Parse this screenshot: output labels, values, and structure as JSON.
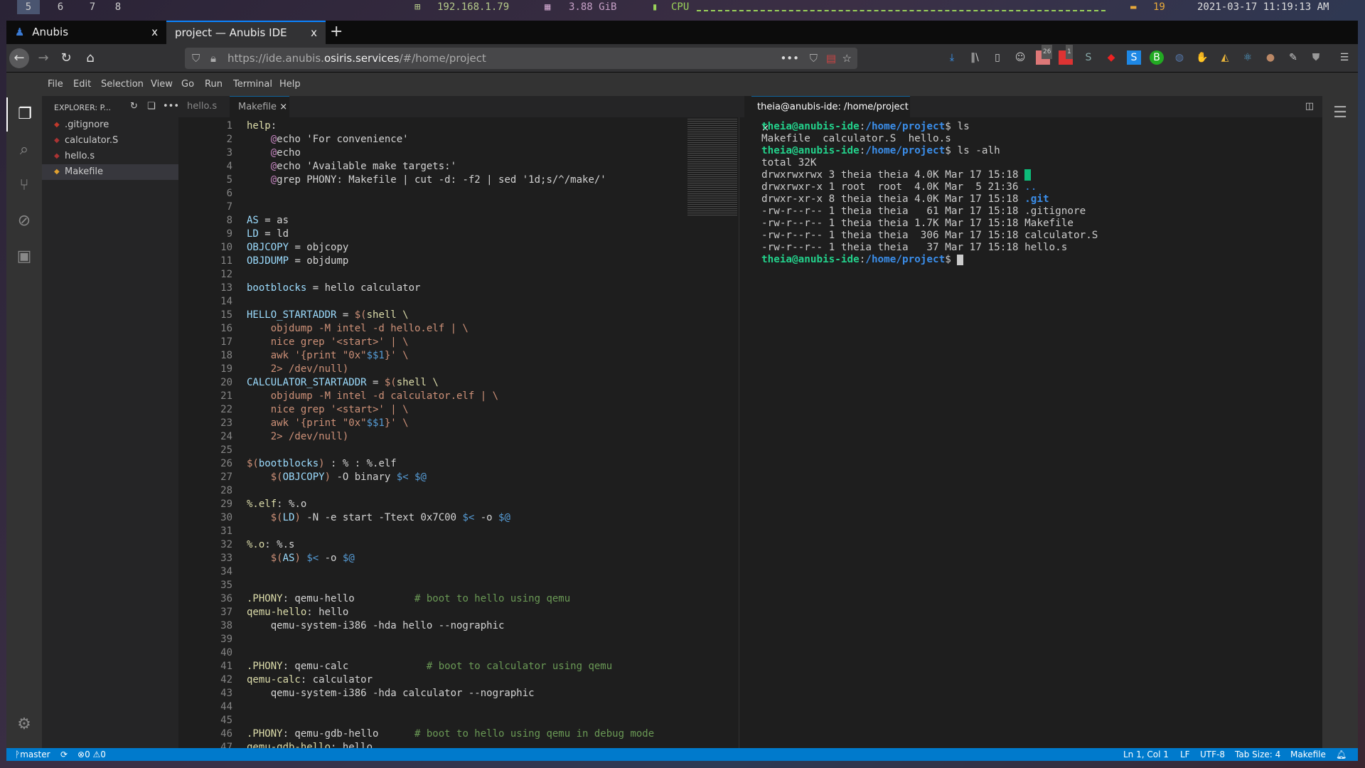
{
  "topbar": {
    "workspaces": [
      "5",
      "6",
      "7",
      "8"
    ],
    "active_workspace": "5",
    "ip": "192.168.1.79",
    "memory": "3.88 GiB",
    "cpu_label": "CPU",
    "disk": "19",
    "datetime": "2021-03-17 11:19:13 AM"
  },
  "browser": {
    "tabs": [
      {
        "title": "Anubis",
        "close": "x"
      },
      {
        "title": "project — Anubis IDE",
        "close": "x",
        "active": true
      }
    ],
    "new_tab": "+",
    "url_prefix": "https://ide.anubis.",
    "url_domain": "osiris.services",
    "url_suffix": "/#/home/project",
    "badges": {
      "ext1": "26",
      "ext2": "1"
    }
  },
  "menu": [
    "File",
    "Edit",
    "Selection",
    "View",
    "Go",
    "Run",
    "Terminal",
    "Help"
  ],
  "explorer": {
    "title": "EXPLORER: P...",
    "files": [
      {
        "name": ".gitignore",
        "icon": "git-icon",
        "color": "#c0392b"
      },
      {
        "name": "calculator.S",
        "icon": "asm-file-icon",
        "color": "#a33"
      },
      {
        "name": "hello.s",
        "icon": "asm-file-icon",
        "color": "#a33"
      },
      {
        "name": "Makefile",
        "icon": "makefile-icon",
        "color": "#e0a030",
        "selected": true
      }
    ]
  },
  "editor": {
    "tabs": [
      {
        "label": "hello.s"
      },
      {
        "label": "Makefile",
        "active": true,
        "close": "×"
      }
    ],
    "lines": [
      [
        [
          "help",
          "tgt"
        ],
        [
          ":",
          ""
        ]
      ],
      [
        [
          "    ",
          ""
        ],
        [
          "@",
          "at"
        ],
        [
          "echo 'For convenience'",
          ""
        ]
      ],
      [
        [
          "    ",
          ""
        ],
        [
          "@",
          "at"
        ],
        [
          "echo",
          ""
        ]
      ],
      [
        [
          "    ",
          ""
        ],
        [
          "@",
          "at"
        ],
        [
          "echo 'Available make targets:'",
          ""
        ]
      ],
      [
        [
          "    ",
          ""
        ],
        [
          "@",
          "at"
        ],
        [
          "grep PHONY: Makefile | cut -d: -f2 | sed '1d;s/^/make/'",
          ""
        ]
      ],
      [],
      [],
      [
        [
          "AS",
          "var"
        ],
        [
          " = as",
          ""
        ]
      ],
      [
        [
          "LD",
          "var"
        ],
        [
          " = ld",
          ""
        ]
      ],
      [
        [
          "OBJCOPY",
          "var"
        ],
        [
          " = objcopy",
          ""
        ]
      ],
      [
        [
          "OBJDUMP",
          "var"
        ],
        [
          " = objdump",
          ""
        ]
      ],
      [],
      [
        [
          "bootblocks",
          "var"
        ],
        [
          " = hello calculator",
          ""
        ]
      ],
      [],
      [
        [
          "HELLO_STARTADDR",
          "var"
        ],
        [
          " = ",
          ""
        ],
        [
          "$(",
          "str"
        ],
        [
          "shell",
          "fn"
        ],
        [
          " \\",
          "fn"
        ]
      ],
      [
        [
          "    objdump -M intel -d hello.elf | \\",
          "str"
        ]
      ],
      [
        [
          "    nice grep '<start>' | \\",
          "str"
        ]
      ],
      [
        [
          "    awk '{print \"0x\"",
          "str"
        ],
        [
          "$$1",
          "auto"
        ],
        [
          "}' \\",
          "str"
        ]
      ],
      [
        [
          "    2> /dev/null)",
          "str"
        ]
      ],
      [
        [
          "CALCULATOR_STARTADDR",
          "var"
        ],
        [
          " = ",
          ""
        ],
        [
          "$(",
          "str"
        ],
        [
          "shell",
          "fn"
        ],
        [
          " \\",
          "fn"
        ]
      ],
      [
        [
          "    objdump -M intel -d calculator.elf | \\",
          "str"
        ]
      ],
      [
        [
          "    nice grep '<start>' | \\",
          "str"
        ]
      ],
      [
        [
          "    awk '{print \"0x\"",
          "str"
        ],
        [
          "$$1",
          "auto"
        ],
        [
          "}' \\",
          "str"
        ]
      ],
      [
        [
          "    2> /dev/null)",
          "str"
        ]
      ],
      [],
      [
        [
          "$(",
          "str"
        ],
        [
          "bootblocks",
          "var"
        ],
        [
          ")",
          "str"
        ],
        [
          " : % : %.elf",
          ""
        ]
      ],
      [
        [
          "    ",
          ""
        ],
        [
          "$(",
          "str"
        ],
        [
          "OBJCOPY",
          "var"
        ],
        [
          ")",
          "str"
        ],
        [
          " -O binary ",
          ""
        ],
        [
          "$<",
          "auto"
        ],
        [
          " ",
          ""
        ],
        [
          "$@",
          "auto"
        ]
      ],
      [],
      [
        [
          "%.elf",
          "tgt"
        ],
        [
          ": %.o",
          ""
        ]
      ],
      [
        [
          "    ",
          ""
        ],
        [
          "$(",
          "str"
        ],
        [
          "LD",
          "var"
        ],
        [
          ")",
          "str"
        ],
        [
          " -N -e start -Ttext 0x7C00 ",
          ""
        ],
        [
          "$<",
          "auto"
        ],
        [
          " -o ",
          ""
        ],
        [
          "$@",
          "auto"
        ]
      ],
      [],
      [
        [
          "%.o",
          "tgt"
        ],
        [
          ": %.s",
          ""
        ]
      ],
      [
        [
          "    ",
          ""
        ],
        [
          "$(",
          "str"
        ],
        [
          "AS",
          "var"
        ],
        [
          ")",
          "str"
        ],
        [
          " ",
          ""
        ],
        [
          "$<",
          "auto"
        ],
        [
          " -o ",
          ""
        ],
        [
          "$@",
          "auto"
        ]
      ],
      [],
      [],
      [
        [
          ".PHONY",
          "tgt"
        ],
        [
          ": qemu-hello          ",
          ""
        ],
        [
          "# boot to hello using qemu",
          "cmt"
        ]
      ],
      [
        [
          "qemu-hello",
          "tgt"
        ],
        [
          ": hello",
          ""
        ]
      ],
      [
        [
          "    qemu-system-i386 -hda hello --nographic",
          ""
        ]
      ],
      [],
      [],
      [
        [
          ".PHONY",
          "tgt"
        ],
        [
          ": qemu-calc             ",
          ""
        ],
        [
          "# boot to calculator using qemu",
          "cmt"
        ]
      ],
      [
        [
          "qemu-calc",
          "tgt"
        ],
        [
          ": calculator",
          ""
        ]
      ],
      [
        [
          "    qemu-system-i386 -hda calculator --nographic",
          ""
        ]
      ],
      [],
      [],
      [
        [
          ".PHONY",
          "tgt"
        ],
        [
          ": qemu-gdb-hello      ",
          ""
        ],
        [
          "# boot to hello using qemu in debug mode",
          "cmt"
        ]
      ],
      [
        [
          "qemu-gdb-hello",
          "tgt"
        ],
        [
          ": hello",
          ""
        ]
      ]
    ]
  },
  "terminal": {
    "tab": "theia@anubis-ide: /home/project",
    "close": "×",
    "lines": [
      [
        [
          "theia@anubis-ide",
          "pu"
        ],
        [
          ":",
          ""
        ],
        [
          "/home/project",
          "pp"
        ],
        [
          "$ ls",
          ""
        ]
      ],
      [
        [
          "Makefile  calculator.S  hello.s",
          ""
        ]
      ],
      [
        [
          "theia@anubis-ide",
          "pu"
        ],
        [
          ":",
          ""
        ],
        [
          "/home/project",
          "pp"
        ],
        [
          "$ ls -alh",
          ""
        ]
      ],
      [
        [
          "total 32K",
          ""
        ]
      ],
      [
        [
          "drwxrwxrwx 3 theia theia 4.0K Mar 17 15:18 ",
          ""
        ],
        [
          ".",
          "hl"
        ]
      ],
      [
        [
          "drwxrwxr-x 1 root  root  4.0K Mar  5 21:36 ",
          ""
        ],
        [
          "..",
          "dir"
        ]
      ],
      [
        [
          "drwxr-xr-x 8 theia theia 4.0K Mar 17 15:18 ",
          ""
        ],
        [
          ".git",
          "dirb"
        ]
      ],
      [
        [
          "-rw-r--r-- 1 theia theia   61 Mar 17 15:18 .gitignore",
          ""
        ]
      ],
      [
        [
          "-rw-r--r-- 1 theia theia 1.7K Mar 17 15:18 Makefile",
          ""
        ]
      ],
      [
        [
          "-rw-r--r-- 1 theia theia  306 Mar 17 15:18 calculator.S",
          ""
        ]
      ],
      [
        [
          "-rw-r--r-- 1 theia theia   37 Mar 17 15:18 hello.s",
          ""
        ]
      ],
      [
        [
          "theia@anubis-ide",
          "pu"
        ],
        [
          ":",
          ""
        ],
        [
          "/home/project",
          "pp"
        ],
        [
          "$ ",
          ""
        ]
      ]
    ]
  },
  "status": {
    "branch": "master",
    "errors": "0",
    "warnings": "0",
    "position": "Ln 1, Col 1",
    "eol": "LF",
    "encoding": "UTF-8",
    "tab_size": "Tab Size: 4",
    "language": "Makefile"
  },
  "colors": {
    "statusbar": "#007acc",
    "accent": "#0a84ff"
  }
}
